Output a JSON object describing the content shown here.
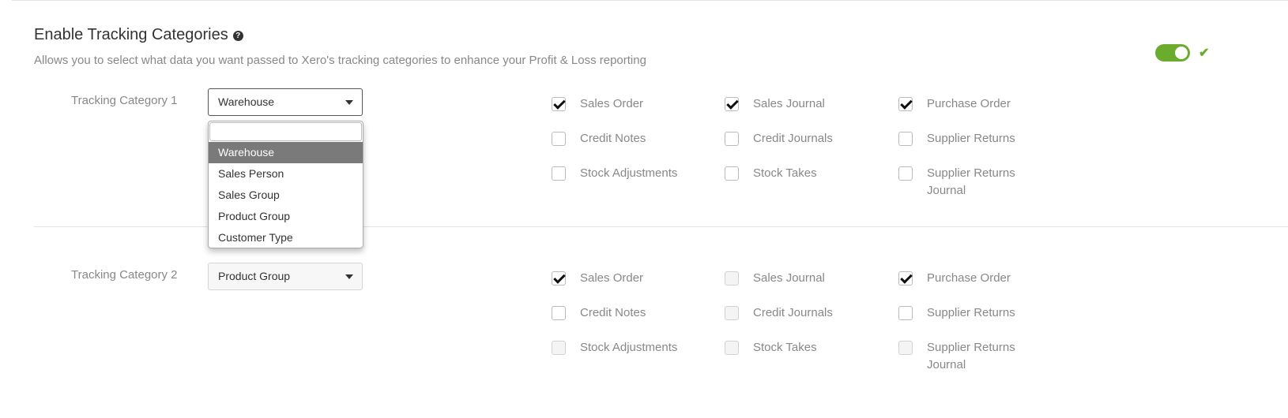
{
  "header": {
    "title": "Enable Tracking Categories",
    "help_icon": "question-circle-icon",
    "subtitle": "Allows you to select what data you want passed to Xero's tracking categories to enhance your Profit & Loss reporting",
    "toggle_on": true,
    "accent_color": "#6bab2d"
  },
  "tracking1": {
    "label": "Tracking Category 1",
    "selected": "Warehouse",
    "dropdown": {
      "search_value": "",
      "options": [
        "Warehouse",
        "Sales Person",
        "Sales Group",
        "Product Group",
        "Customer Type"
      ],
      "highlighted": "Warehouse"
    },
    "checkboxes": {
      "sales_order": "Sales Order",
      "sales_journal": "Sales Journal",
      "purchase_order": "Purchase Order",
      "credit_notes": "Credit Notes",
      "credit_journals": "Credit Journals",
      "supplier_returns": "Supplier Returns",
      "stock_adjustments": "Stock Adjustments",
      "stock_takes": "Stock Takes",
      "supplier_returns_journal": "Supplier Returns Journal"
    }
  },
  "tracking2": {
    "label": "Tracking Category 2",
    "selected": "Product Group",
    "checkboxes": {
      "sales_order": "Sales Order",
      "sales_journal": "Sales Journal",
      "purchase_order": "Purchase Order",
      "credit_notes": "Credit Notes",
      "credit_journals": "Credit Journals",
      "supplier_returns": "Supplier Returns",
      "stock_adjustments": "Stock Adjustments",
      "stock_takes": "Stock Takes",
      "supplier_returns_journal": "Supplier Returns Journal"
    }
  }
}
